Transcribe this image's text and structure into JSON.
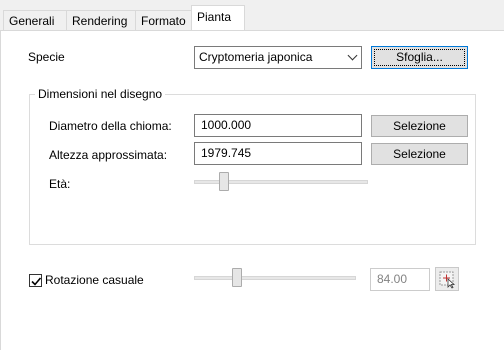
{
  "tabs": [
    {
      "label": "Generali",
      "active": false
    },
    {
      "label": "Rendering",
      "active": false
    },
    {
      "label": "Formato",
      "active": false
    },
    {
      "label": "Pianta",
      "active": true
    }
  ],
  "species": {
    "label": "Specie",
    "value": "Cryptomeria japonica",
    "browse_label": "Sfoglia..."
  },
  "dimensions": {
    "title": "Dimensioni nel disegno",
    "crown_diameter": {
      "label": "Diametro della chioma:",
      "value": "1000.000",
      "button": "Selezione"
    },
    "approx_height": {
      "label": "Altezza approssimata:",
      "value": "1979.745",
      "button": "Selezione"
    },
    "age": {
      "label": "Età:",
      "slider_level": 0.15
    }
  },
  "random_rotation": {
    "label": "Rotazione casuale",
    "checked": true,
    "slider_level": 0.25,
    "value": "84.00"
  },
  "icons": {
    "checkbox": "checkmark-icon",
    "combo": "chevron-down-icon",
    "pick": "pick-angle-icon"
  }
}
